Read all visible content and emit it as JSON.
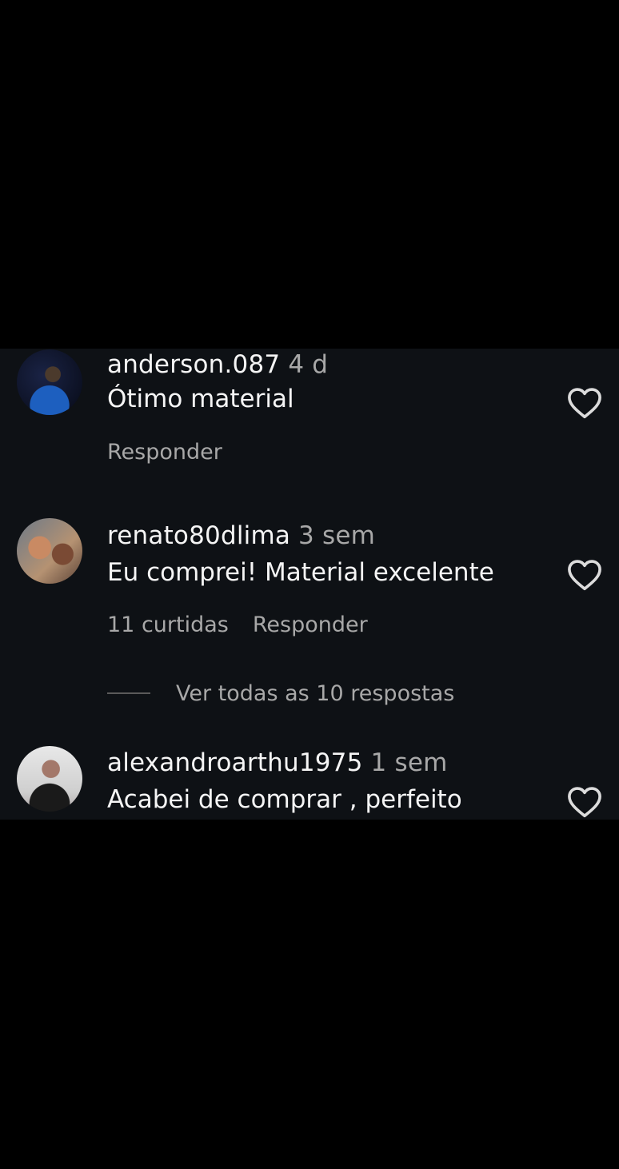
{
  "comments": [
    {
      "username": "anderson.087",
      "time": "4 d",
      "text": "Ótimo material",
      "reply_label": "Responder"
    },
    {
      "username": "renato80dlima",
      "time": "3 sem",
      "text": "Eu comprei! Material excelente",
      "likes_label": "11 curtidas",
      "reply_label": "Responder",
      "view_replies_label": "Ver todas as 10 respostas"
    },
    {
      "username": "alexandroarthu1975",
      "time": "1 sem",
      "text": "Acabei de comprar , perfeito"
    }
  ],
  "icons": {
    "like": "heart-outline-icon"
  },
  "colors": {
    "background": "#000000",
    "panel": "#0e1115",
    "primary_text": "#f5f5f5",
    "secondary_text": "#a8a8a8"
  }
}
